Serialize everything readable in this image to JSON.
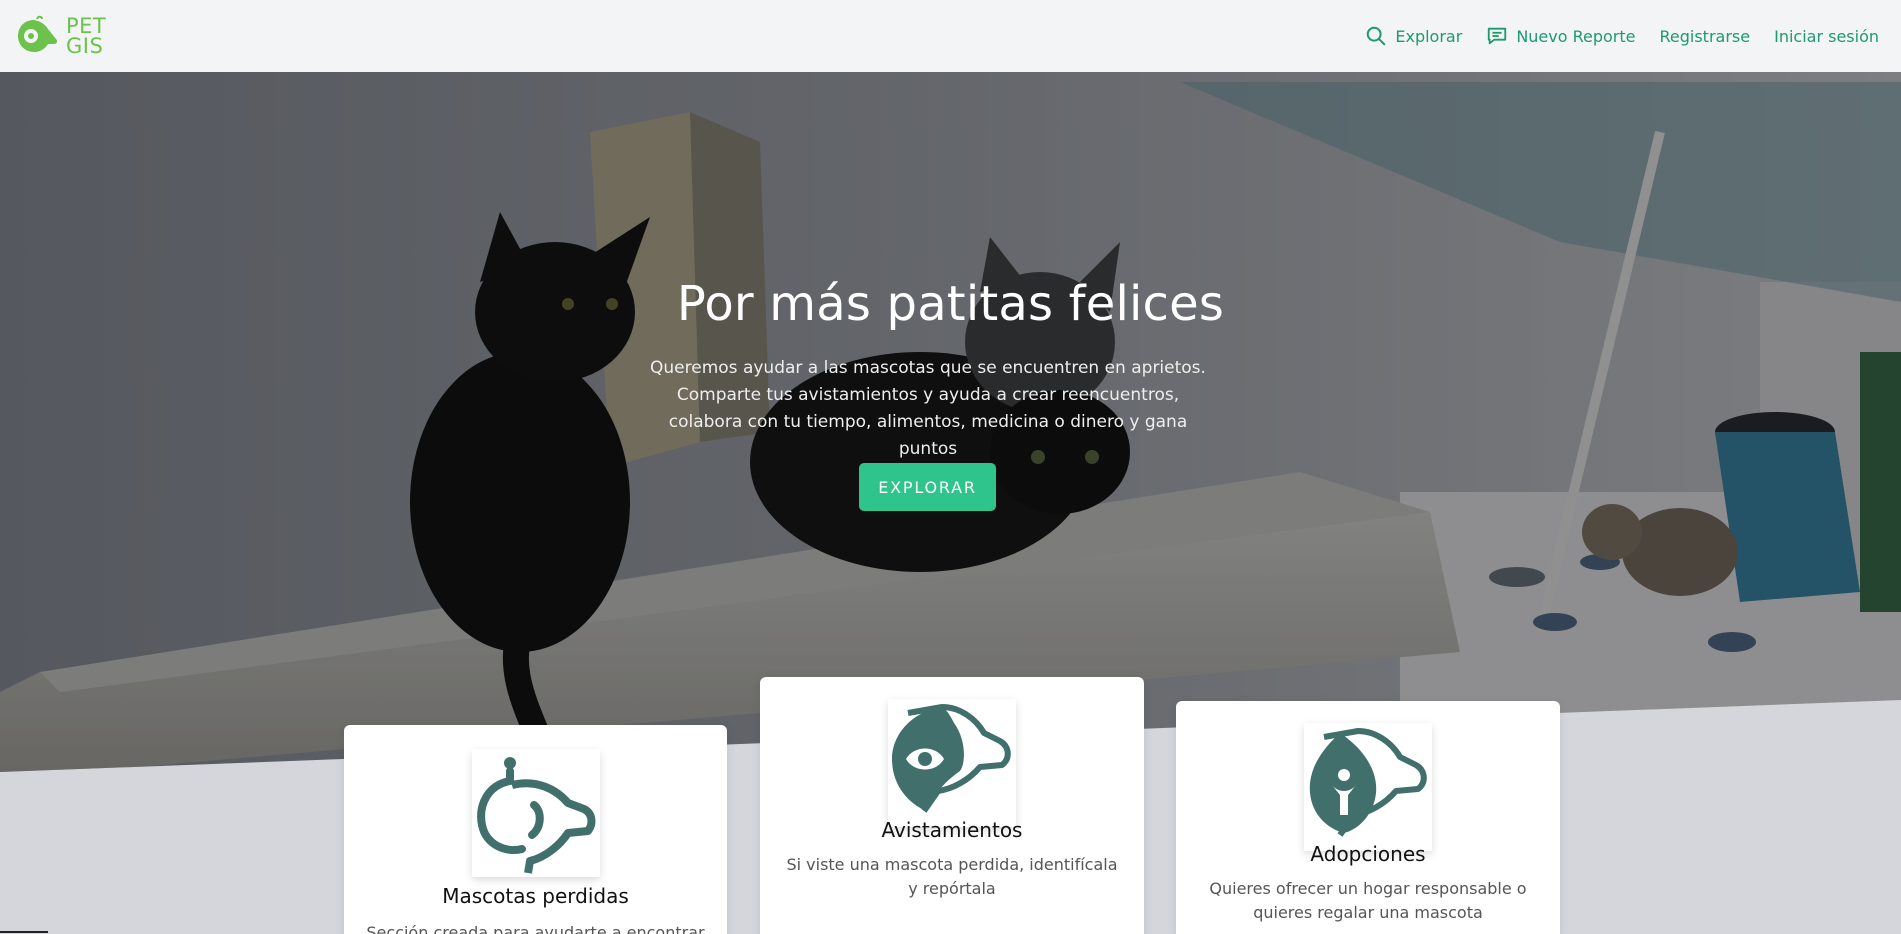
{
  "brand": {
    "line1": "PET",
    "line2": "GIS"
  },
  "nav": {
    "explore": "Explorar",
    "new_report": "Nuevo Reporte",
    "register": "Registrarse",
    "login": "Iniciar sesión"
  },
  "hero": {
    "title": "Por más patitas felices",
    "description": "Queremos ayudar a las mascotas que se encuentren en aprietos. Comparte tus avistamientos y ayuda a crear reencuentros, colabora con tu tiempo, alimentos, medicina o dinero y gana puntos",
    "button": "EXPLORAR"
  },
  "cards": [
    {
      "title": "Mascotas perdidas",
      "description": "Sección creada para ayudarte a encontrar a tus",
      "icon": "dog-lost-icon"
    },
    {
      "title": "Avistamientos",
      "description": "Si viste una mascota perdida, identifícala y repórtala",
      "icon": "dog-eye-icon"
    },
    {
      "title": "Adopciones",
      "description": "Quieres ofrecer un hogar responsable o quieres regalar una mascota",
      "icon": "dog-leaf-icon"
    }
  ],
  "colors": {
    "accent": "#1f9a6d",
    "button": "#2fc48b",
    "brand_green": "#6cc24a",
    "icon_teal": "#41706c"
  }
}
